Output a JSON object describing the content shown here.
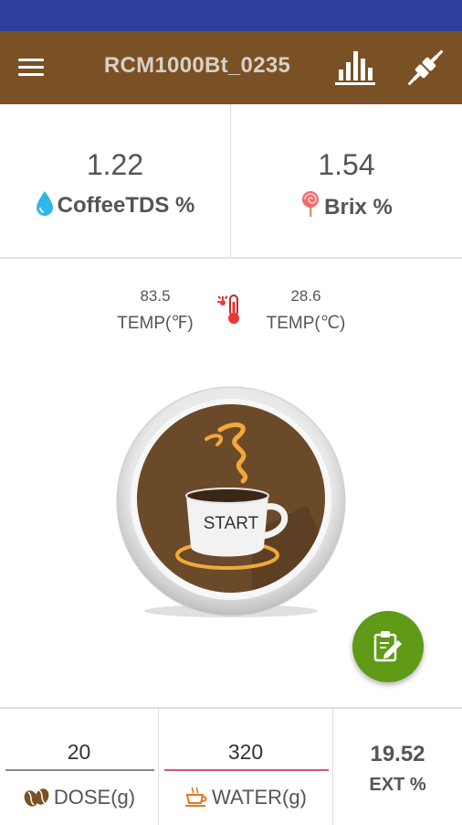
{
  "app": {
    "title": "RCM1000Bt_0235",
    "colors": {
      "status_bar": "#2f3f9e",
      "app_bar": "#7a5124",
      "fab": "#5f9b16",
      "water_underline": "#d5537a"
    },
    "icons": {
      "menu": "menu-icon",
      "chart": "bar-chart-icon",
      "connect": "plug-icon"
    }
  },
  "metrics": {
    "coffee_tds": {
      "value": "1.22",
      "label": "CoffeeTDS %",
      "icon": "water-drop-icon"
    },
    "brix": {
      "value": "1.54",
      "label": "Brix %",
      "icon": "lollipop-icon"
    }
  },
  "temperature": {
    "fahrenheit_value": "83.5",
    "fahrenheit_label": "TEMP(℉)",
    "celsius_value": "28.6",
    "celsius_label": "TEMP(℃)",
    "icon": "thermometer-icon"
  },
  "start_button": {
    "label": "START"
  },
  "fab": {
    "icon": "clipboard-edit-icon"
  },
  "inputs": {
    "dose": {
      "value": "20",
      "label": "DOSE(g)",
      "icon": "coffee-beans-icon"
    },
    "water": {
      "value": "320",
      "label": "WATER(g)",
      "icon": "coffee-cup-icon"
    }
  },
  "extraction": {
    "value": "19.52",
    "label": "EXT %"
  }
}
